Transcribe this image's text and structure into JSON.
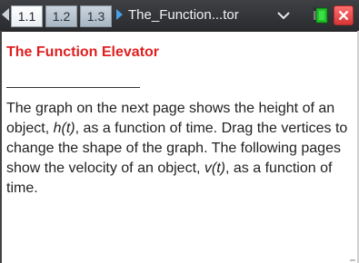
{
  "tabs": [
    {
      "label": "1.1",
      "active": true
    },
    {
      "label": "1.2",
      "active": false
    },
    {
      "label": "1.3",
      "active": false
    }
  ],
  "document_title": "The_Function...tor",
  "icons": {
    "nav_left": "left-arrow-icon",
    "nav_right": "right-arrow-icon",
    "dropdown": "chevron-down-icon",
    "battery": "battery-icon",
    "close": "close-icon"
  },
  "colors": {
    "heading": "#e02020",
    "tabbar": "#2f3033",
    "close": "#e04040",
    "battery_green": "#22c32a"
  },
  "content": {
    "heading": "The Function Elevator",
    "paragraph": {
      "p1": "The graph on the next page shows the height of an object, ",
      "h_var": "h(t)",
      "p2": ", as a function of time.  Drag the vertices to change the shape of the graph.  The following pages show the velocity of an object, ",
      "v_var": "v(t)",
      "p3": ", as a function of time."
    }
  }
}
